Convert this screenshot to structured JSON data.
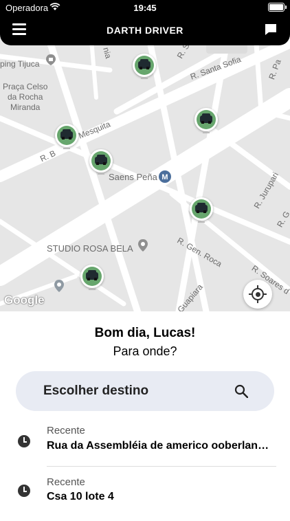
{
  "status_bar": {
    "carrier": "Operadora",
    "time": "19:45"
  },
  "nav": {
    "title": "DARTH DRIVER",
    "menu_icon": "hamburger-icon",
    "chat_icon": "chat-bubble-icon"
  },
  "map": {
    "labels": {
      "ping_tijuca": "ping Tijuca",
      "praca": "Praça Celso\nda Rocha\nMiranda",
      "mesquita": "Mesquita",
      "r_b": "R. B",
      "saens_pena": "Saens Peña",
      "studio": "STUDIO ROSA BELA",
      "gen_roca": "R. Gen. Roca",
      "santa_sofia": "R. Santa Sofia",
      "jurupari": "R. Jurupari",
      "soares": "R. Soares d",
      "guapiara": "Guapiara",
      "r_g": "R. G",
      "r_s": "R. S",
      "r_pa": "R. Pa",
      "nia": "nia"
    },
    "google": "Google",
    "car_pin_icon": "car-pin-icon",
    "locate_icon": "my-location-icon"
  },
  "greeting": {
    "title": "Bom dia, Lucas!",
    "question": "Para onde?"
  },
  "search": {
    "label": "Escolher destino",
    "icon": "search-icon"
  },
  "recents": [
    {
      "tag": "Recente",
      "address": "Rua da Assembléia de americo ooberlan…",
      "icon": "clock-icon"
    },
    {
      "tag": "Recente",
      "address": "Csa 10 lote 4",
      "icon": "clock-icon"
    }
  ]
}
